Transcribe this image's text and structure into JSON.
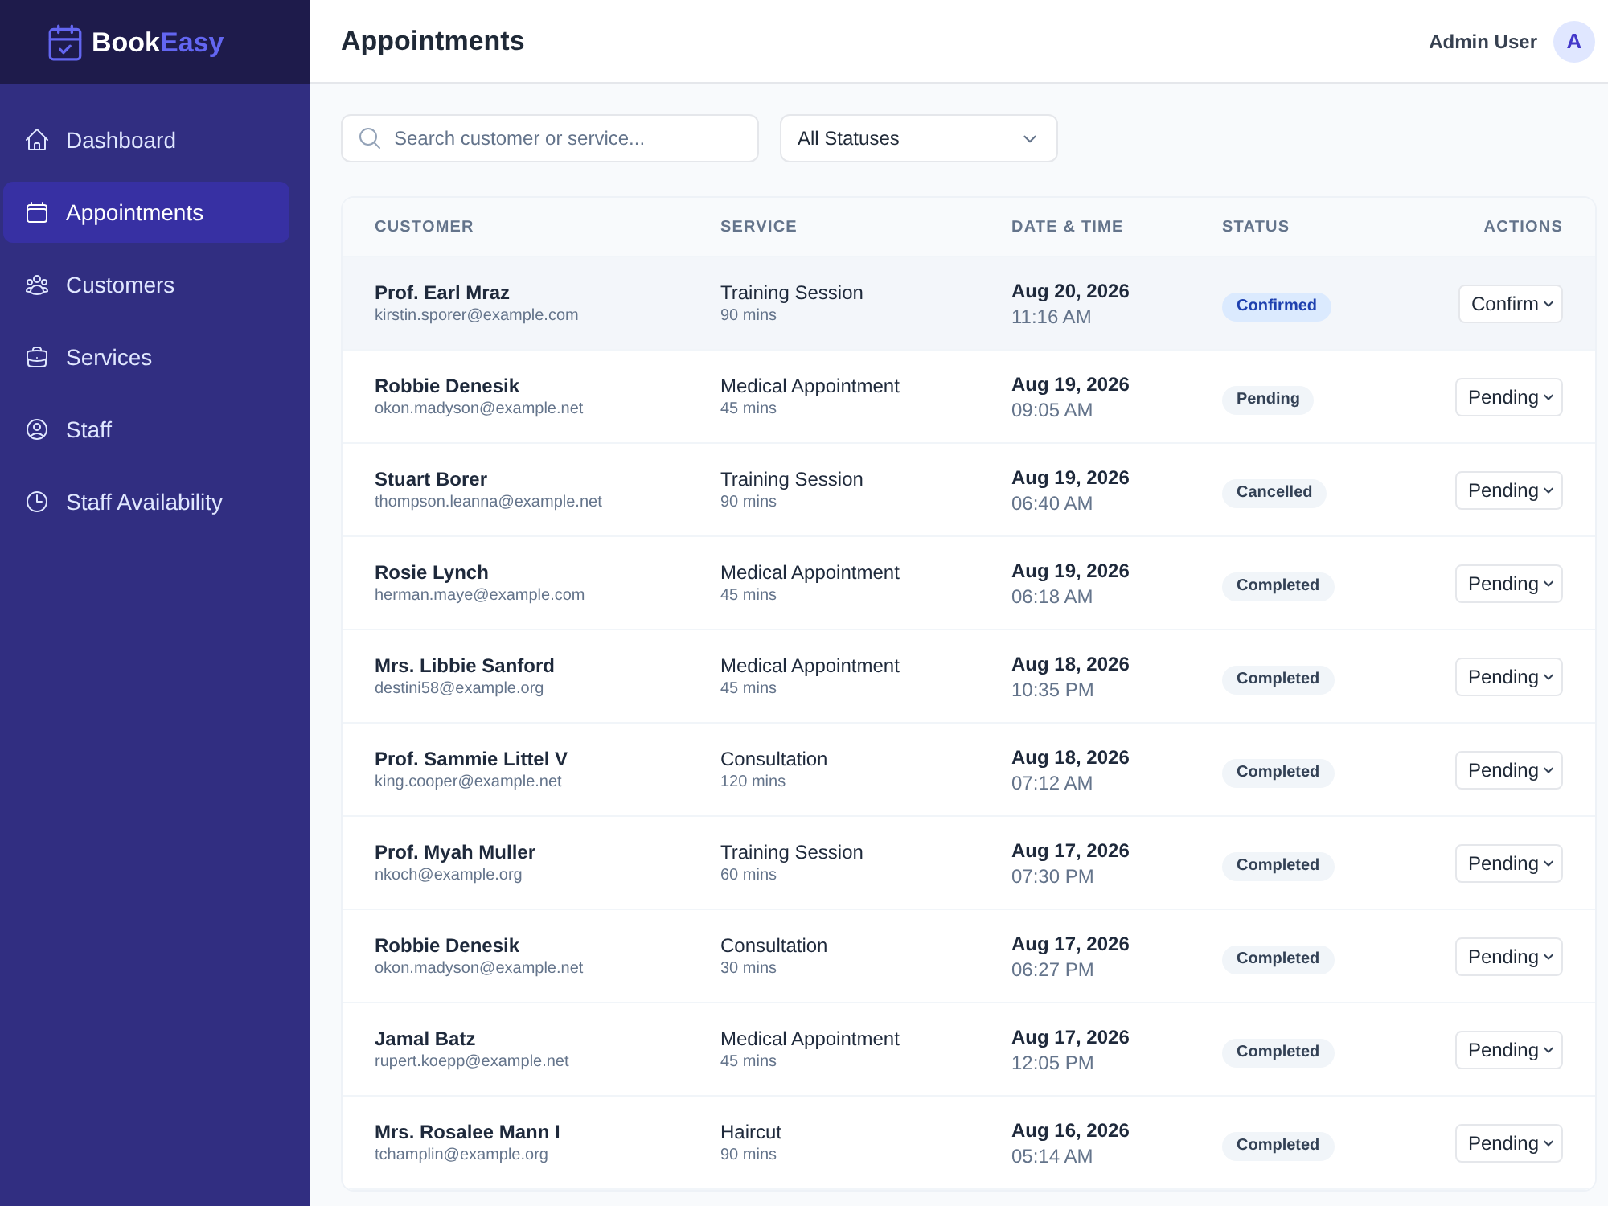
{
  "brand": {
    "name_first": "Book",
    "name_second": "Easy"
  },
  "sidebar": {
    "items": [
      {
        "label": "Dashboard",
        "selected": false
      },
      {
        "label": "Appointments",
        "selected": true
      },
      {
        "label": "Customers",
        "selected": false
      },
      {
        "label": "Services",
        "selected": false
      },
      {
        "label": "Staff",
        "selected": false
      },
      {
        "label": "Staff Availability",
        "selected": false
      }
    ]
  },
  "header": {
    "title": "Appointments",
    "user": {
      "name": "Admin User",
      "initial": "A"
    }
  },
  "filters": {
    "search": {
      "placeholder": "Search customer or service..."
    },
    "status_select": {
      "value": "All Statuses"
    }
  },
  "table": {
    "columns": [
      "CUSTOMER",
      "SERVICE",
      "DATE & TIME",
      "STATUS",
      "ACTIONS"
    ],
    "rows": [
      {
        "customer": "Prof. Earl Mraz",
        "email": "kirstin.sporer@example.com",
        "service": "Training Session",
        "duration": "90 mins",
        "date": "Aug 20, 2026",
        "time": "11:16 AM",
        "status": {
          "label": "Confirmed",
          "color": "#dbeafe"
        },
        "action": "Confirm",
        "hovered": true
      },
      {
        "customer": "Robbie Denesik",
        "email": "okon.madyson@example.net",
        "service": "Medical Appointment",
        "duration": "45 mins",
        "date": "Aug 19, 2026",
        "time": "09:05 AM",
        "status": {
          "label": "Pending",
          "color": "#f1f5f9"
        },
        "action": "Pending",
        "hovered": false
      },
      {
        "customer": "Stuart Borer",
        "email": "thompson.leanna@example.net",
        "service": "Training Session",
        "duration": "90 mins",
        "date": "Aug 19, 2026",
        "time": "06:40 AM",
        "status": {
          "label": "Cancelled",
          "color": "#f1f5f9"
        },
        "action": "Pending",
        "hovered": false
      },
      {
        "customer": "Rosie Lynch",
        "email": "herman.maye@example.com",
        "service": "Medical Appointment",
        "duration": "45 mins",
        "date": "Aug 19, 2026",
        "time": "06:18 AM",
        "status": {
          "label": "Completed",
          "color": "#f1f5f9"
        },
        "action": "Pending",
        "hovered": false
      },
      {
        "customer": "Mrs. Libbie Sanford",
        "email": "destini58@example.org",
        "service": "Medical Appointment",
        "duration": "45 mins",
        "date": "Aug 18, 2026",
        "time": "10:35 PM",
        "status": {
          "label": "Completed",
          "color": "#f1f5f9"
        },
        "action": "Pending",
        "hovered": false
      },
      {
        "customer": "Prof. Sammie Littel V",
        "email": "king.cooper@example.net",
        "service": "Consultation",
        "duration": "120 mins",
        "date": "Aug 18, 2026",
        "time": "07:12 AM",
        "status": {
          "label": "Completed",
          "color": "#f1f5f9"
        },
        "action": "Pending",
        "hovered": false
      },
      {
        "customer": "Prof. Myah Muller",
        "email": "nkoch@example.org",
        "service": "Training Session",
        "duration": "60 mins",
        "date": "Aug 17, 2026",
        "time": "07:30 PM",
        "status": {
          "label": "Completed",
          "color": "#f1f5f9"
        },
        "action": "Pending",
        "hovered": false
      },
      {
        "customer": "Robbie Denesik",
        "email": "okon.madyson@example.net",
        "service": "Consultation",
        "duration": "30 mins",
        "date": "Aug 17, 2026",
        "time": "06:27 PM",
        "status": {
          "label": "Completed",
          "color": "#f1f5f9"
        },
        "action": "Pending",
        "hovered": false
      },
      {
        "customer": "Jamal Batz",
        "email": "rupert.koepp@example.net",
        "service": "Medical Appointment",
        "duration": "45 mins",
        "date": "Aug 17, 2026",
        "time": "12:05 PM",
        "status": {
          "label": "Completed",
          "color": "#f1f5f9"
        },
        "action": "Pending",
        "hovered": false
      },
      {
        "customer": "Mrs. Rosalee Mann I",
        "email": "tchamplin@example.org",
        "service": "Haircut",
        "duration": "90 mins",
        "date": "Aug 16, 2026",
        "time": "05:14 AM",
        "status": {
          "label": "Completed",
          "color": "#f1f5f9"
        },
        "action": "Pending",
        "hovered": false
      }
    ]
  }
}
